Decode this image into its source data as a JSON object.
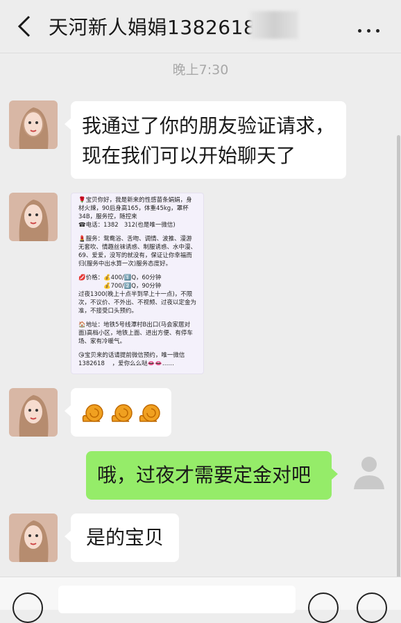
{
  "header": {
    "title": "天河新人娟娟1382618",
    "back_icon": "chevron-left-icon",
    "more_icon": "more-icon"
  },
  "timestamp": "晚上7:30",
  "messages": [
    {
      "side": "left",
      "text_lines": [
        "我通过了你的朋友验证请求，",
        "现在我们可以开始聊天了"
      ]
    },
    {
      "side": "left",
      "type": "image"
    },
    {
      "side": "left",
      "type": "emoji",
      "emoji": "snail-emoji"
    },
    {
      "side": "right",
      "text": "哦，过夜才需要定金对吧"
    },
    {
      "side": "left",
      "text": "是的宝贝"
    }
  ],
  "poster": {
    "intro": "🌹宝贝你好，我是新来的性感苗条娟娟，身材火辣，90后身高165，体重45kg，罩杯34B，服务控，随控来",
    "phone": "☎电话：1382   312(也是唯一微信)",
    "service": "💄服务：鸳鸯浴、舌吻、调情、波推、漫游无套吹、情趣丝袜诱惑、制服诱惑、水中漫、69、爱爱，没写的就没有，保证让你幸福而归(服务中出水算一次)服务态度好。",
    "price_1": "💋价格：💰400/1️⃣Q，60分钟",
    "price_2": "💰700/2️⃣Q，90分钟",
    "overnight": "过夜1300(晚上十点半到早上十一点)，不限次，不议价、不外出、不视频、过夜以定金为准，不接受口头预约。",
    "address": "🏠地址：地铁5号线潭村B出口(马会家居对面)高档小区，地铁上面、进出方便、有停车场、家有冷暖气。",
    "appointment": "😘宝贝来的话请提前微信预约，唯一微信",
    "closing": "1382618    ，爱你么么哒👄👄……"
  },
  "colors": {
    "background": "#ededed",
    "bubble_left": "#ffffff",
    "bubble_right": "#95ec69"
  }
}
